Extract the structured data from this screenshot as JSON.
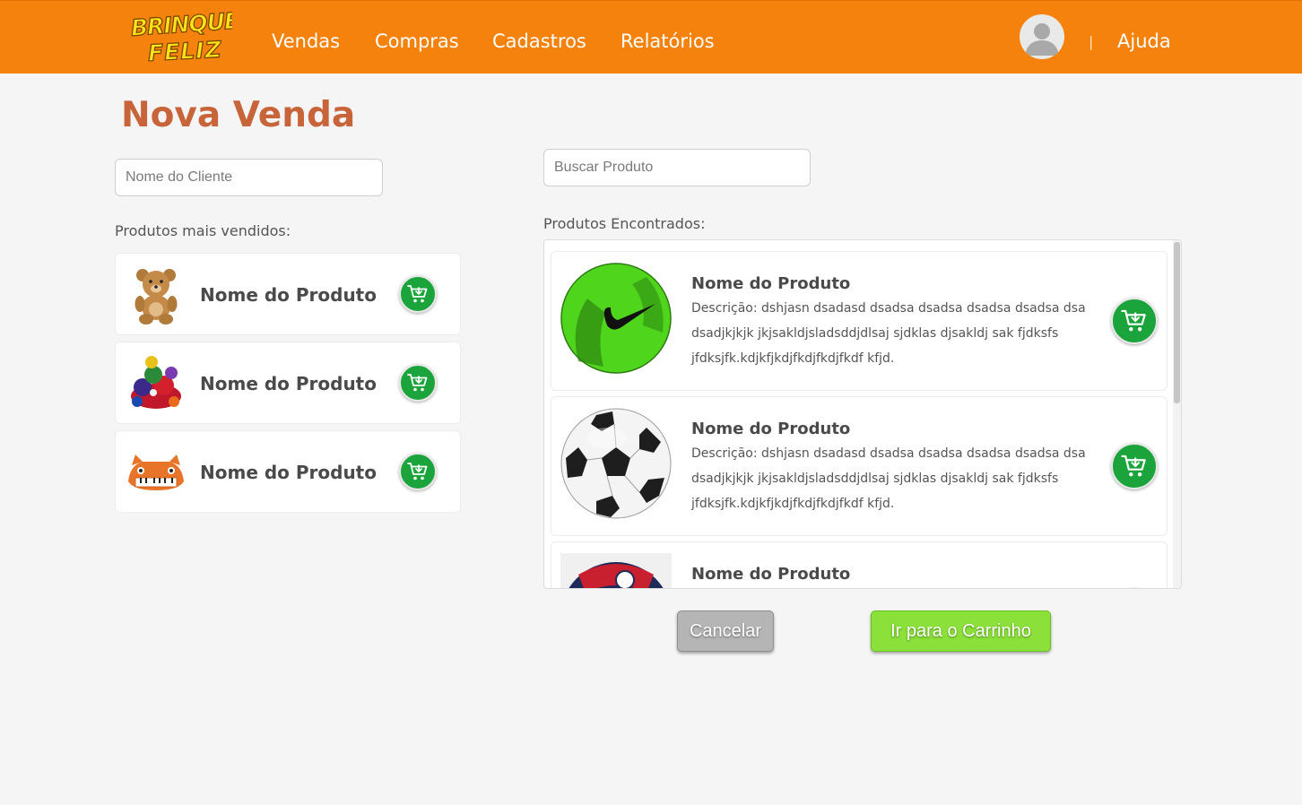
{
  "header": {
    "logo_text": "BRINQUE FELIZ",
    "nav": [
      "Vendas",
      "Compras",
      "Cadastros",
      "Relatórios"
    ],
    "separator": "|",
    "help": "Ajuda"
  },
  "page": {
    "title": "Nova Venda"
  },
  "client": {
    "placeholder": "Nome do Cliente",
    "value": ""
  },
  "search": {
    "placeholder": "Buscar Produto",
    "value": ""
  },
  "best_sellers": {
    "label": "Produtos mais vendidos:",
    "items": [
      {
        "name": "Nome do Produto",
        "image": "teddy-bear"
      },
      {
        "name": "Nome do Produto",
        "image": "plush-toy-pile"
      },
      {
        "name": "Nome do Produto",
        "image": "cat-piano-toy"
      }
    ]
  },
  "results": {
    "label": "Produtos Encontrados:",
    "items": [
      {
        "name": "Nome do Produto",
        "description": "Descrição: dshjasn dsadasd dsadsa dsadsa dsadsa dsadsa dsa dsadjkjkjk jkjsakldjsladsddjdlsaj sjdklas djsakldj sak fjdksfs jfdksjfk.kdjkfjkdjfkdjfkdjfkdf kfjd.",
        "image": "green-nike-ball"
      },
      {
        "name": "Nome do Produto",
        "description": "Descrição: dshjasn dsadasd dsadsa dsadsa dsadsa dsadsa dsa dsadjkjkjk jkjsakldjsladsddjdlsaj sjdklas djsakldj sak fjdksfs jfdksjfk.kdjkfjkdjfkdjfkdjfkdf kfjd.",
        "image": "classic-soccer-ball"
      },
      {
        "name": "Nome do Produto",
        "description": "",
        "image": "psg-ball"
      }
    ]
  },
  "actions": {
    "cancel": "Cancelar",
    "go_to_cart": "Ir para o Carrinho"
  },
  "colors": {
    "header": "#f5820c",
    "title": "#c8643a",
    "cart_button": "#1aa43b",
    "go_to_cart": "#8be03a",
    "cancel": "#b5b5b5"
  },
  "icons": {
    "cart": "cart-plus-icon",
    "avatar": "user-avatar-icon"
  }
}
